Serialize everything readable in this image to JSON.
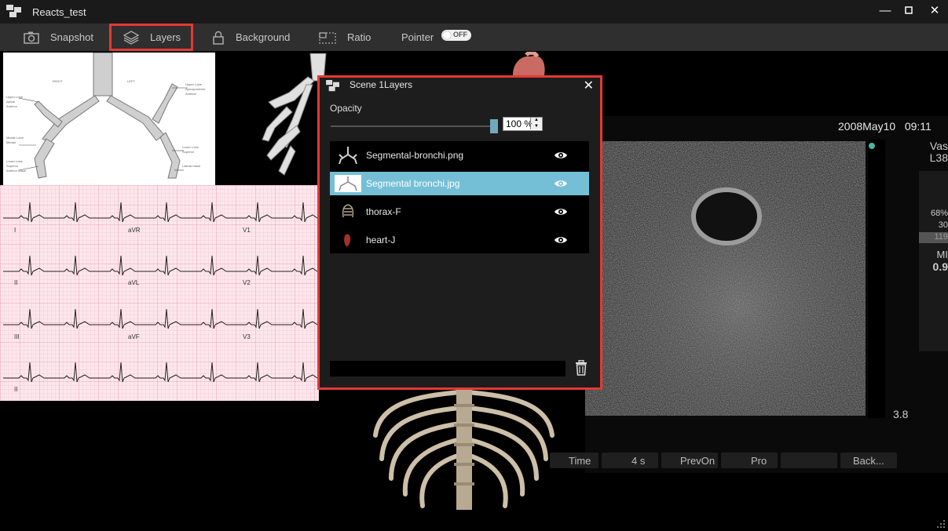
{
  "window": {
    "title": "Reacts_test",
    "minimize_icon": "minimize-icon",
    "maximize_icon": "maximize-icon",
    "close_icon": "close-icon"
  },
  "toolbar": {
    "snapshot_label": "Snapshot",
    "layers_label": "Layers",
    "background_label": "Background",
    "ratio_label": "Ratio",
    "pointer_label": "Pointer",
    "pointer_toggle_state": "OFF"
  },
  "ultrasound": {
    "date": "2008May10",
    "time": "09:11",
    "probe_top": "Vas",
    "probe_model": "L38",
    "readout_1": "68%",
    "readout_2": "30",
    "readout_3": "119",
    "mi_label": "MI",
    "mi_value": "0.9",
    "depth": "3.8",
    "btn_time": "Time",
    "btn_duration": "4 s",
    "btn_prevon": "PrevOn",
    "btn_pro": "Pro",
    "btn_back": "Back..."
  },
  "ecg": {
    "labels": [
      "I",
      "aVR",
      "V1",
      "II",
      "aVL",
      "V2",
      "III",
      "aVF",
      "V3",
      "II"
    ]
  },
  "dialog": {
    "title": "Scene 1Layers",
    "opacity_label": "Opacity",
    "opacity_value": "100 %",
    "opacity_fraction": 1.0,
    "layers": [
      {
        "name": "Segmental-bronchi.png",
        "selected": false,
        "visible": true,
        "thumb_icon": "bronchi-thumb-icon"
      },
      {
        "name": "Segmental bronchi.jpg",
        "selected": true,
        "visible": true,
        "thumb_icon": "bronchi-diagram-thumb-icon"
      },
      {
        "name": "thorax-F",
        "selected": false,
        "visible": true,
        "thumb_icon": "thorax-thumb-icon"
      },
      {
        "name": "heart-J",
        "selected": false,
        "visible": true,
        "thumb_icon": "heart-thumb-icon"
      }
    ],
    "layer_name_value": "",
    "delete_icon": "trash-icon"
  },
  "colors": {
    "highlight": "#e53935",
    "selection": "#74bfd6",
    "slider_thumb": "#6fa9c0"
  }
}
